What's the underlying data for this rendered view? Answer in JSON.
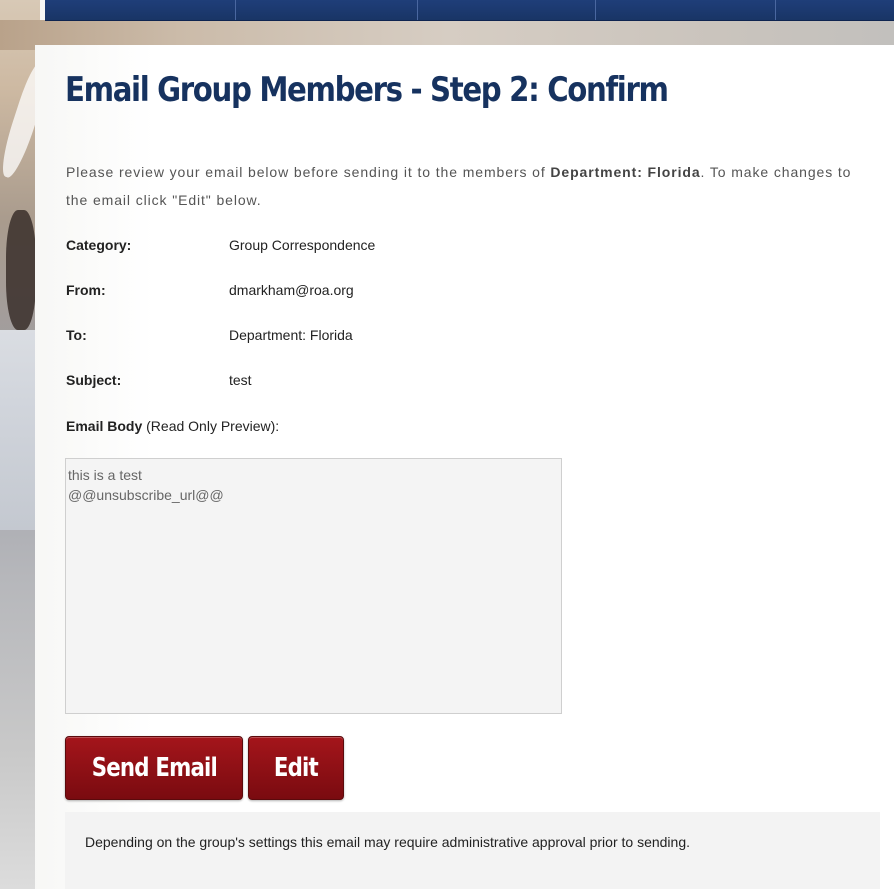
{
  "page": {
    "title": "Email Group Members - Step 2: Confirm",
    "intro": {
      "part1": "Please review your email below before sending it to the members of ",
      "group_name": "Department: Florida",
      "part2": ". To make changes to the email click \"Edit\" below."
    }
  },
  "fields": {
    "category": {
      "label": "Category:",
      "value": "Group Correspondence"
    },
    "from": {
      "label": "From:",
      "value": "dmarkham@roa.org"
    },
    "to": {
      "label": "To:",
      "value": "Department: Florida"
    },
    "subject": {
      "label": "Subject:",
      "value": "test"
    }
  },
  "email_body": {
    "label": "Email Body",
    "label_note": " (Read Only Preview):",
    "lines": [
      "this is a test",
      "@@unsubscribe_url@@"
    ]
  },
  "actions": {
    "send_label": "Send Email",
    "edit_label": "Edit"
  },
  "notice": "Depending on the group's settings this email may require administrative approval prior to sending.",
  "colors": {
    "title": "#16325f",
    "button": "#8e1015",
    "nav": "#1f3e79"
  }
}
